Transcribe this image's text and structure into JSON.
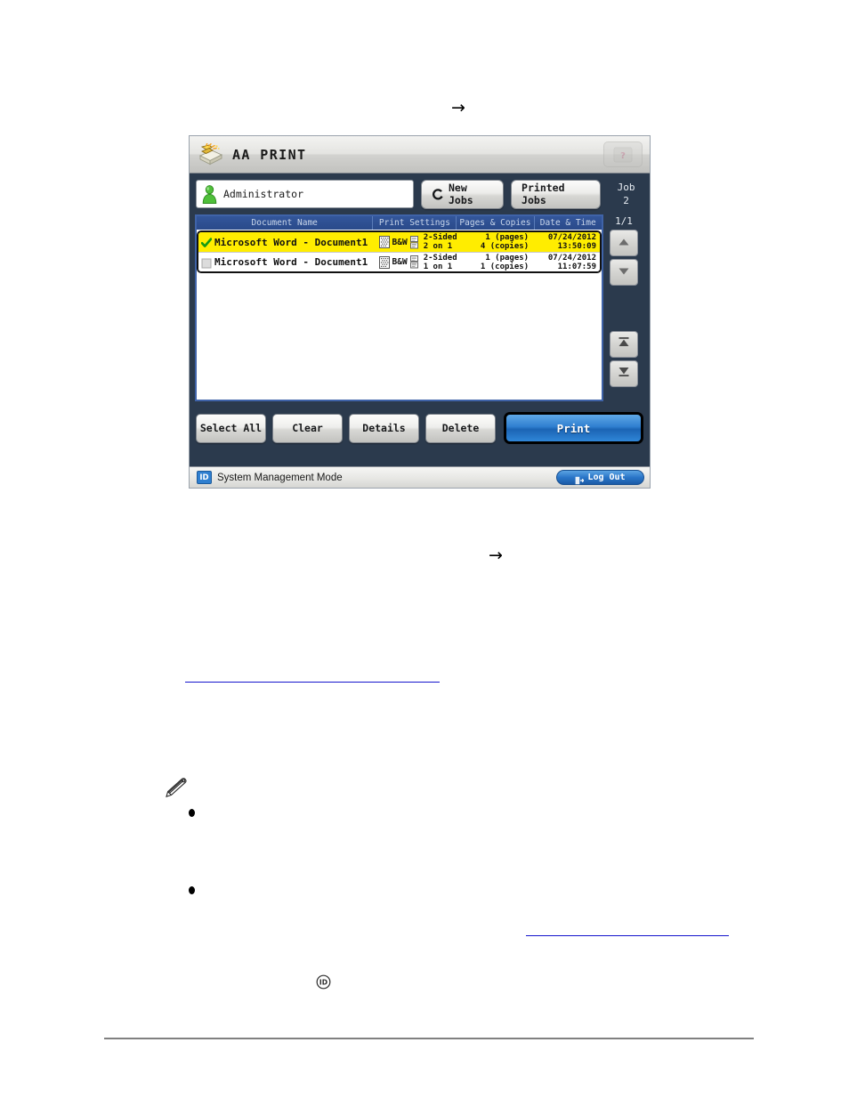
{
  "document": {
    "arrows": [
      "→",
      "→"
    ],
    "note_icon": "pencil-note-icon",
    "id_glyph": "circled-id-icon"
  },
  "panel": {
    "title": "AA PRINT",
    "title_icon": "print-job-icon",
    "help_icon": "help-icon",
    "user": {
      "icon": "user-person-icon",
      "name": "Administrator"
    },
    "buttons": {
      "new_jobs": "New Jobs",
      "new_jobs_icon": "refresh-icon",
      "printed_jobs": "Printed Jobs"
    },
    "job_counter": {
      "label": "Job",
      "value": "2"
    },
    "columns": {
      "document_name": "Document Name",
      "print_settings": "Print Settings",
      "pages_copies": "Pages & Copies",
      "date_time": "Date & Time"
    },
    "rows": [
      {
        "selected": true,
        "checkbox": "checked",
        "document_name": "Microsoft Word - Document1",
        "color_mode": "B&W",
        "duplex": "2-Sided",
        "nup": "2 on 1",
        "pages": "1 (pages)",
        "copies": "4 (copies)",
        "date": "07/24/2012",
        "time": "13:50:09"
      },
      {
        "selected": false,
        "checkbox": "unchecked",
        "document_name": "Microsoft Word - Document1",
        "color_mode": "B&W",
        "duplex": "2-Sided",
        "nup": "1 on 1",
        "pages": "1 (pages)",
        "copies": "1 (copies)",
        "date": "07/24/2012",
        "time": "11:07:59"
      }
    ],
    "scroll": {
      "page_indicator": "1/1",
      "up_icon": "arrow-up-icon",
      "down_icon": "arrow-down-icon",
      "first_icon": "jump-to-first-icon",
      "last_icon": "jump-to-last-icon"
    },
    "actions": {
      "select_all": "Select All",
      "clear": "Clear",
      "details": "Details",
      "delete": "Delete",
      "print": "Print"
    },
    "status": {
      "id_badge": "ID",
      "text": "System Management Mode",
      "logout": "Log Out",
      "logout_icon": "logout-icon"
    },
    "colors": {
      "panel_bg": "#2b3a4d",
      "selected_row": "#ffed00",
      "header_blue": "#2a4a8a",
      "print_blue": "#2f7fd0",
      "link_blue": "#1414cd"
    }
  }
}
